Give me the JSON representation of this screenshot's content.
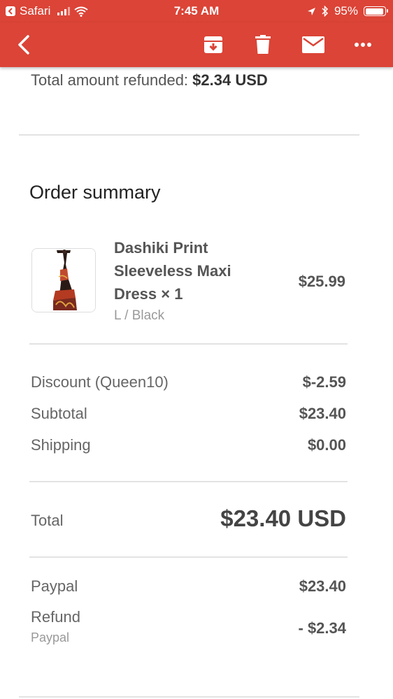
{
  "status_bar": {
    "back_app": "Safari",
    "time": "7:45 AM",
    "battery": "95%",
    "battery_level": 0.95
  },
  "toolbar": {
    "icons": [
      "back-arrow-icon",
      "archive-icon",
      "trash-icon",
      "mail-icon",
      "more-icon"
    ]
  },
  "refund": {
    "label": "Total amount refunded:",
    "amount": "$2.34 USD"
  },
  "order_summary": {
    "title": "Order summary",
    "item": {
      "name": "Dashiki Print Sleeveless Maxi Dress × 1",
      "variant": "L / Black",
      "price": "$25.99"
    },
    "discount": {
      "label": "Discount (Queen10)",
      "value": "$-2.59"
    },
    "subtotal": {
      "label": "Subtotal",
      "value": "$23.40"
    },
    "shipping": {
      "label": "Shipping",
      "value": "$0.00"
    },
    "total": {
      "label": "Total",
      "value": "$23.40 USD"
    },
    "paypal": {
      "label": "Paypal",
      "value": "$23.40"
    },
    "refund": {
      "label": "Refund",
      "sub": "Paypal",
      "value": "- $2.34"
    }
  },
  "colors": {
    "header": "#db4437",
    "text": "#555555"
  }
}
